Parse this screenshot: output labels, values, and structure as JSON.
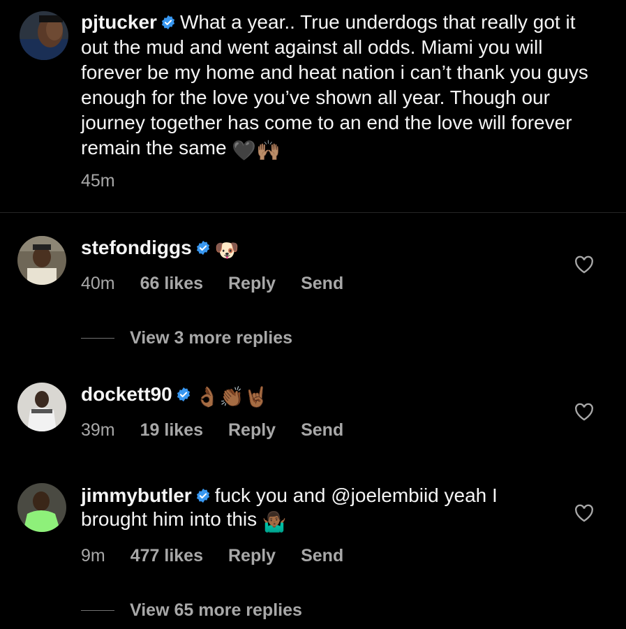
{
  "caption": {
    "username": "pjtucker",
    "text": "What a year.. True underdogs that really got it out the mud and went against all odds. Miami you will forever be my home and heat nation i can’t thank you guys enough for the love you’ve shown all year. Though our journey together has come to an end the love will forever remain the same",
    "emoji": "🖤🙌🏽",
    "time": "45m"
  },
  "comments": [
    {
      "username": "stefondiggs",
      "text": "",
      "emoji": "🐶",
      "time": "40m",
      "likes": "66 likes",
      "reply": "Reply",
      "send": "Send",
      "view_replies": "View 3 more replies"
    },
    {
      "username": "dockett90",
      "text": "",
      "emoji": "👌🏾👏🏾🤘🏾",
      "time": "39m",
      "likes": "19 likes",
      "reply": "Reply",
      "send": "Send",
      "view_replies": ""
    },
    {
      "username": "jimmybutler",
      "text": "fuck you and @joelembiid yeah I brought him into this",
      "emoji": "🤷🏾‍♂️",
      "time": "9m",
      "likes": "477 likes",
      "reply": "Reply",
      "send": "Send",
      "view_replies": "View 65 more replies"
    }
  ],
  "colors": {
    "background": "#000000",
    "text": "#f5f5f5",
    "secondary": "#a8a8a8",
    "verified": "#3897f0"
  }
}
